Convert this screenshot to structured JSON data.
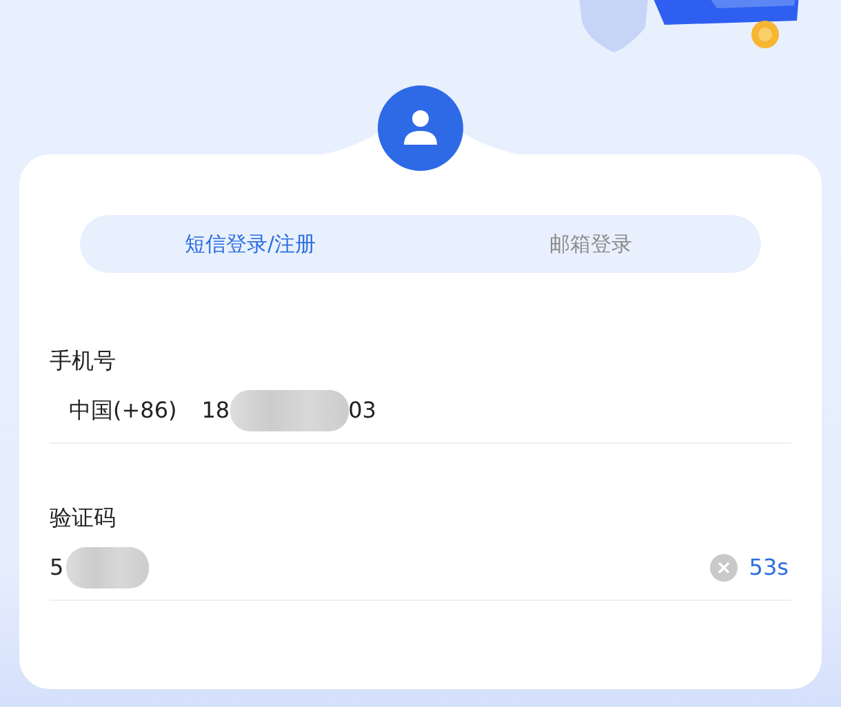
{
  "tabs": [
    {
      "label": "短信登录/注册",
      "selected": true
    },
    {
      "label": "邮箱登录",
      "selected": false
    }
  ],
  "phone": {
    "label": "手机号",
    "country_code": "中国(+86)",
    "value_start": "18",
    "value_end": "03",
    "redacted": true
  },
  "code": {
    "label": "验证码",
    "value_start": "5",
    "redacted": true,
    "countdown": "53s"
  }
}
